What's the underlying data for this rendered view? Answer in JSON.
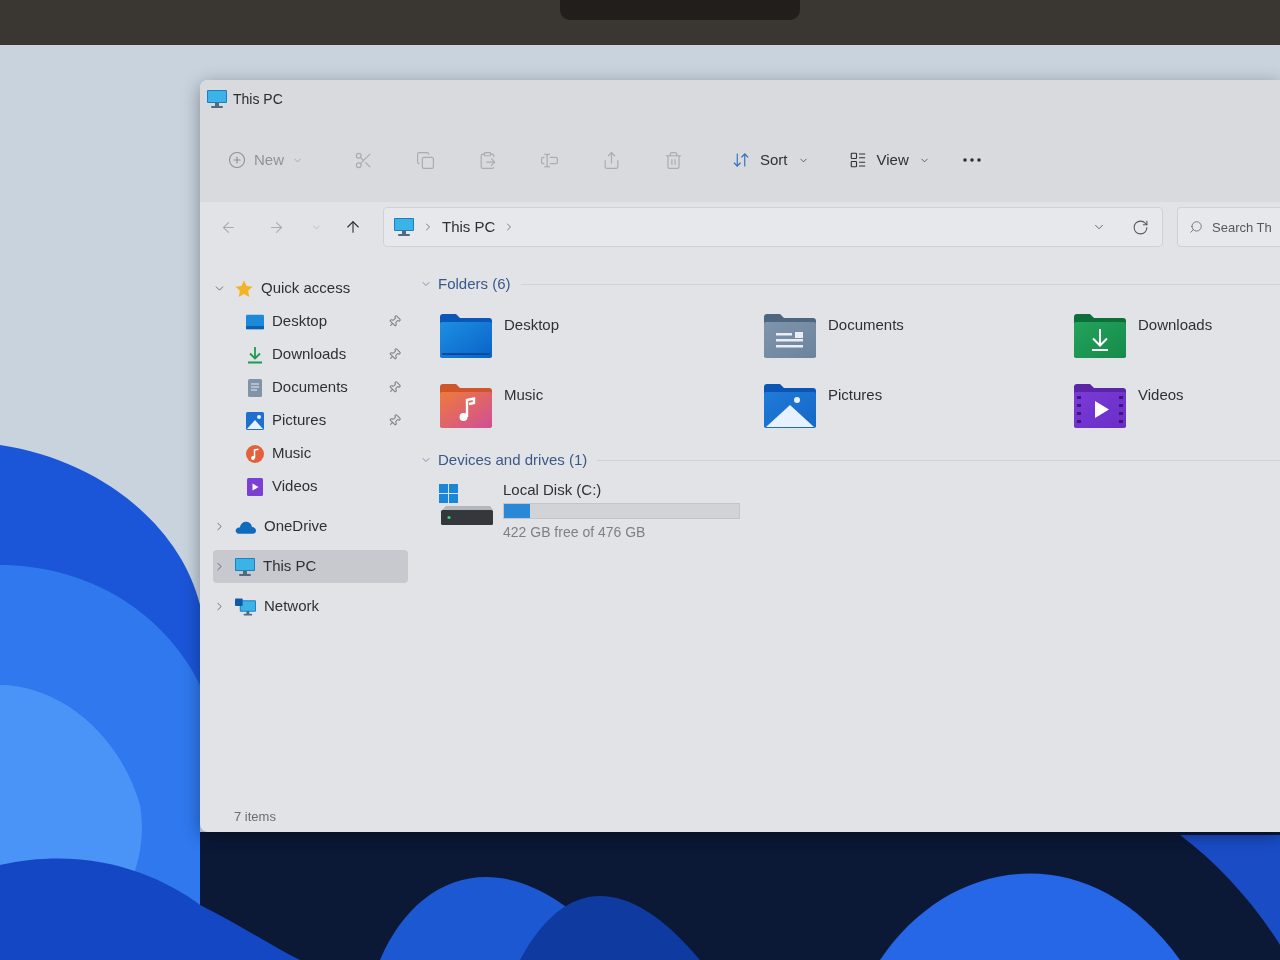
{
  "window": {
    "title": "This PC"
  },
  "command_bar": {
    "new": {
      "label": "New",
      "disabled": true
    },
    "actions": [
      {
        "disabled": true
      },
      {
        "disabled": true
      },
      {
        "disabled": true
      },
      {
        "disabled": true
      },
      {
        "disabled": true
      },
      {
        "disabled": true
      }
    ],
    "sort": {
      "label": "Sort",
      "disabled": false
    },
    "view": {
      "label": "View",
      "disabled": false
    }
  },
  "navigation": {
    "back": {
      "disabled": true
    },
    "forward": {
      "disabled": true
    },
    "recent": {
      "disabled": true
    },
    "up": {
      "disabled": false
    }
  },
  "address_bar": {
    "breadcrumb": [
      "This PC"
    ]
  },
  "search": {
    "placeholder": "Search Th"
  },
  "sidebar": {
    "items": [
      {
        "label": "Quick access",
        "kind": "quick_access",
        "selected": false,
        "expanded": true,
        "children": [
          {
            "label": "Desktop",
            "kind": "desktop",
            "selected": false,
            "pinned": true
          },
          {
            "label": "Downloads",
            "kind": "downloads",
            "selected": false,
            "pinned": true
          },
          {
            "label": "Documents",
            "kind": "documents",
            "selected": false,
            "pinned": true
          },
          {
            "label": "Pictures",
            "kind": "pictures",
            "selected": false,
            "pinned": true
          },
          {
            "label": "Music",
            "kind": "music",
            "selected": false,
            "pinned": false
          },
          {
            "label": "Videos",
            "kind": "videos",
            "selected": false,
            "pinned": false
          }
        ]
      },
      {
        "label": "OneDrive",
        "kind": "cloud",
        "selected": false,
        "expanded": false
      },
      {
        "label": "This PC",
        "kind": "pc",
        "selected": true,
        "expanded": false
      },
      {
        "label": "Network",
        "kind": "network",
        "selected": false,
        "expanded": false
      }
    ]
  },
  "sections": [
    {
      "title": "Folders (6)",
      "kind": "folders",
      "expanded": true,
      "items": [
        {
          "label": "Desktop",
          "kind": "desktop"
        },
        {
          "label": "Documents",
          "kind": "documents"
        },
        {
          "label": "Downloads",
          "kind": "downloads"
        },
        {
          "label": "Music",
          "kind": "music"
        },
        {
          "label": "Pictures",
          "kind": "pictures"
        },
        {
          "label": "Videos",
          "kind": "videos"
        }
      ]
    },
    {
      "title": "Devices and drives (1)",
      "kind": "drives",
      "expanded": true,
      "items": [
        {
          "label": "Local Disk (C:)",
          "level": 0.11,
          "reading": "422 GB free of 476 GB"
        }
      ]
    }
  ],
  "status_bar": {
    "text": "7 items"
  }
}
